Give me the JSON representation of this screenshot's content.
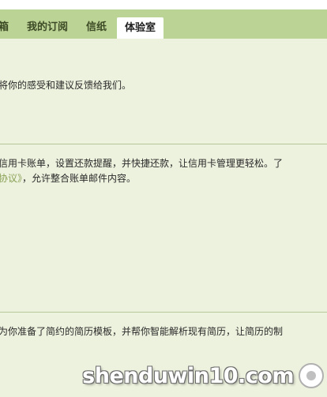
{
  "tabs": [
    {
      "label": "箱",
      "active": false
    },
    {
      "label": "我的订阅",
      "active": false
    },
    {
      "label": "信纸",
      "active": false
    },
    {
      "label": "体验室",
      "active": true
    }
  ],
  "sections": [
    {
      "line1": "将你的感受和建议反馈给我们。"
    },
    {
      "line1": "信用卡账单，设置还款提醒，并快捷还款，让信用卡管理更轻松。了",
      "line2_link": "协议》",
      "line2_rest": "，允许整合账单邮件内容。"
    },
    {
      "line1": "为你准备了简约的简历模板，并帮你智能解析现有简历，让简历的制"
    }
  ],
  "watermark": {
    "text": "shenduwin10.com"
  },
  "colors": {
    "tab_bar": "#bcd396",
    "content_bg": "#edf2de",
    "link": "#8aa256",
    "divider": "#b7c79a"
  }
}
